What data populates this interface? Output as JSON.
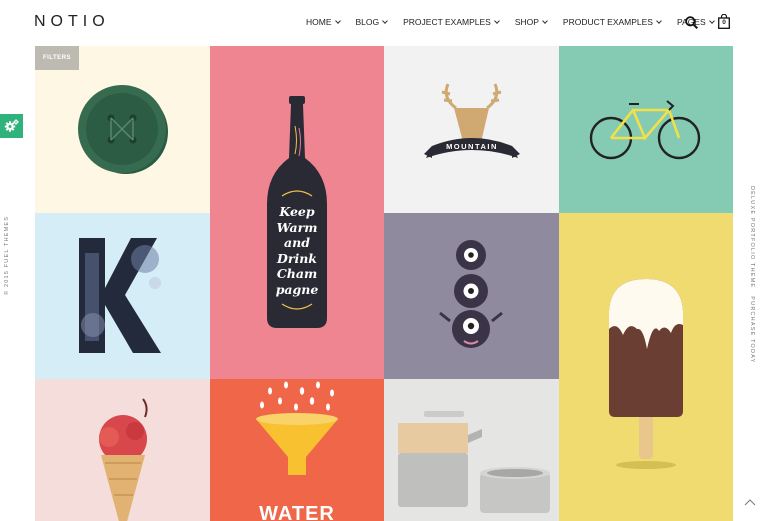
{
  "brand": {
    "logo": "NOTIO"
  },
  "nav": {
    "items": [
      {
        "label": "HOME"
      },
      {
        "label": "BLOG"
      },
      {
        "label": "PROJECT EXAMPLES"
      },
      {
        "label": "SHOP"
      },
      {
        "label": "PRODUCT EXAMPLES"
      },
      {
        "label": "PAGES"
      }
    ],
    "cart_count": "0"
  },
  "filters_label": "FILTERS",
  "left_copyright": "© 2015 FUEL THEMES",
  "right_vertical": {
    "tagline": "DELUXE PORTFOLIO THEME",
    "purchase": "PURCHASE TODAY"
  },
  "tiles": [
    {
      "name": "button",
      "bg": "#fdf7e3"
    },
    {
      "name": "champagne-bottle",
      "bg": "#f08592",
      "text_lines": [
        "Keep",
        "Warm",
        "and",
        "Drink",
        "Cham",
        "pagne"
      ]
    },
    {
      "name": "mountain-deer",
      "bg": "#f2f2f2",
      "text": "MOUNTAIN"
    },
    {
      "name": "bicycle",
      "bg": "#85cbb3"
    },
    {
      "name": "letter-k",
      "bg": "#d5edf6"
    },
    {
      "name": "monster",
      "bg": "#8f8a9d"
    },
    {
      "name": "popsicle",
      "bg": "#efdb6f"
    },
    {
      "name": "ice-cream-cone",
      "bg": "#f4dddb"
    },
    {
      "name": "water-funnel",
      "bg": "#f06648",
      "text": "WATER"
    },
    {
      "name": "teapot",
      "bg": "#e5e5e3"
    }
  ],
  "colors": {
    "accent": "#2fb27b",
    "filter_bg": "#bdbab1"
  }
}
